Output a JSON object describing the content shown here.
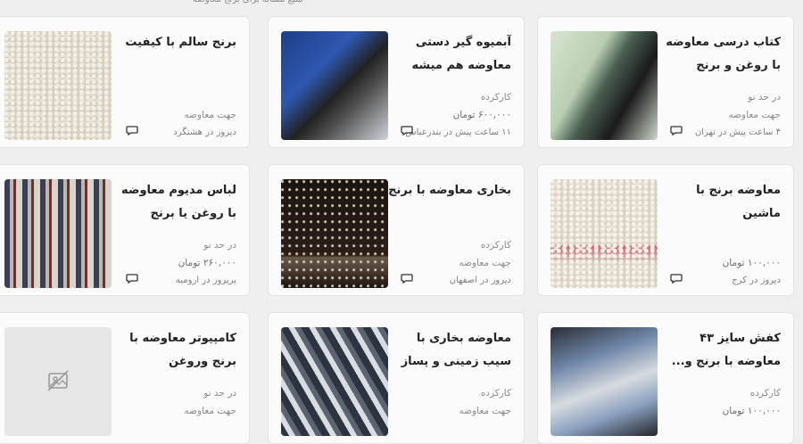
{
  "top_text": "تبلیغ مشابه برای برنج معاوضه",
  "cards": [
    {
      "title": "کتاب درسی معاوضه با روغن و برنج",
      "line1": "در حد نو",
      "line2": "جهت معاوضه",
      "price": "",
      "time": "۴ ساعت پیش در تهران",
      "thumb_icon": "book-photo-icon"
    },
    {
      "title": "آبمیوه گیر دستی معاوضه هم میشه با...",
      "line1": "کارکرده",
      "line2": "",
      "price": "۶۰۰,۰۰۰ تومان",
      "time": "۱۱ ساعت پیش در بندرعباس",
      "thumb_icon": "juicer-photo-icon"
    },
    {
      "title": "برنج سالم با کیفیت",
      "line1": "",
      "line2": "جهت معاوضه",
      "price": "",
      "time": "دیروز در هشتگرد",
      "thumb_icon": "rice-photo-icon"
    },
    {
      "title": "معاوضه برنج با ماشین",
      "line1": "",
      "line2": "",
      "price": "۱۰۰,۰۰۰ تومان",
      "time": "دیروز در کرج",
      "thumb_icon": "rice-photo-icon"
    },
    {
      "title": "بخاری معاوضه با برنج",
      "line1": "کارکرده",
      "line2": "جهت معاوضه",
      "price": "",
      "time": "دیروز در اصفهان",
      "thumb_icon": "heater-photo-icon"
    },
    {
      "title": "لباس مدیوم معاوضه با روغن یا برنج",
      "line1": "در حد نو",
      "line2": "",
      "price": "۲۶۰,۰۰۰ تومان",
      "time": "پریروز در ارومیه",
      "thumb_icon": "shirt-photo-icon"
    },
    {
      "title": "کفش سایز ۴۳ معاوضه با برنج و...",
      "line1": "کارکرده",
      "line2": "",
      "price": "۱۰۰,۰۰۰ تومان",
      "time": "",
      "thumb_icon": "shoe-photo-icon"
    },
    {
      "title": "معاوضه بخاری با سیب زمینی و پساز ...",
      "line1": "کارکرده",
      "line2": "جهت معاوضه",
      "price": "",
      "time": "",
      "thumb_icon": "heater-photo-icon"
    },
    {
      "title": "کامپیوتر معاوضه با برنج وروغن",
      "line1": "در حد نو",
      "line2": "جهت معاوضه",
      "price": "",
      "time": "",
      "thumb_icon": "no-image-icon"
    }
  ],
  "icons": {
    "chat": "chat-bubble-icon",
    "no_image": "no-image-icon"
  },
  "colors": {
    "background": "#efefef",
    "card": "#fbfbfb",
    "title": "#222222",
    "meta": "#8a8a8a"
  }
}
